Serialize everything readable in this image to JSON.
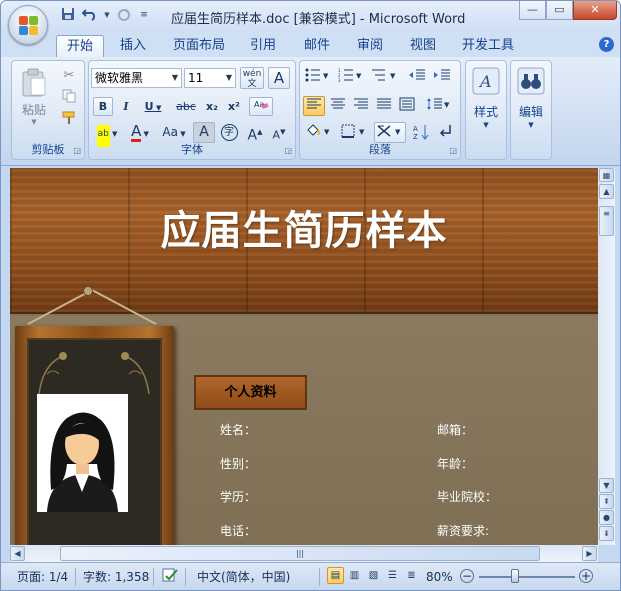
{
  "window": {
    "title": "应届生简历样本.doc [兼容模式] - Microsoft Word",
    "controls": {
      "minimize": "—",
      "restore": "▭",
      "close": "✕"
    }
  },
  "qat": {
    "save_icon": "floppy-disk-icon",
    "undo_icon": "undo-icon",
    "redo_icon": "redo-icon",
    "customize_icon": "dropdown-icon"
  },
  "tabs": [
    "开始",
    "插入",
    "页面布局",
    "引用",
    "邮件",
    "审阅",
    "视图",
    "开发工具"
  ],
  "active_tab": "开始",
  "ribbon": {
    "clipboard": {
      "label": "剪贴板",
      "paste": "粘贴"
    },
    "font": {
      "label": "字体",
      "font_name": "微软雅黑",
      "font_size": "11",
      "bold": "B",
      "italic": "I",
      "underline": "U",
      "strike": "abc",
      "subscript": "x₂",
      "superscript": "x²",
      "grow": "A",
      "shrink": "A",
      "case": "Aa",
      "char_shading": "A",
      "enclose": "字",
      "phonetic": "wén 文"
    },
    "paragraph": {
      "label": "段落"
    },
    "styles": {
      "label": "样式"
    },
    "editing": {
      "label": "编辑"
    }
  },
  "document": {
    "title": "应届生简历样本",
    "section_title": "个人资料",
    "fields_left": [
      "姓名：",
      "性别：",
      "学历：",
      "电话："
    ],
    "fields_right": [
      "邮箱：",
      "年龄：",
      "毕业院校：",
      "薪资要求:"
    ]
  },
  "status": {
    "page": "页面: 1/4",
    "words": "字数: 1,358",
    "language": "中文(简体，中国)",
    "zoom": "80%"
  },
  "colors": {
    "accent": "#15428b",
    "wood": "#a5602a",
    "panel": "#83725a",
    "close": "#c6482b"
  }
}
